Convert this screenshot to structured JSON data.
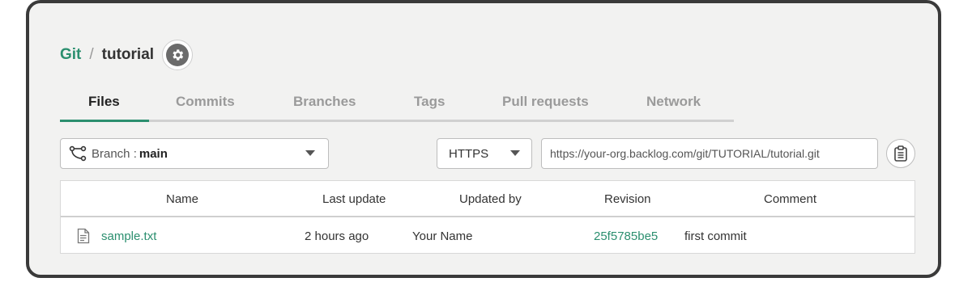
{
  "breadcrumb": {
    "project": "Git",
    "separator": "/",
    "repository": "tutorial",
    "settings_icon": "gear-icon"
  },
  "tabs": [
    {
      "label": "Files",
      "active": true
    },
    {
      "label": "Commits",
      "active": false
    },
    {
      "label": "Branches",
      "active": false
    },
    {
      "label": "Tags",
      "active": false
    },
    {
      "label": "Pull requests",
      "active": false
    },
    {
      "label": "Network",
      "active": false
    }
  ],
  "branch_select": {
    "icon": "branch-icon",
    "label": "Branch :",
    "value": "main"
  },
  "clone": {
    "protocol": "HTTPS",
    "url": "https://your-org.backlog.com/git/TUTORIAL/tutorial.git",
    "copy_icon": "clipboard-icon"
  },
  "table": {
    "columns": [
      "Name",
      "Last update",
      "Updated by",
      "Revision",
      "Comment"
    ],
    "rows": [
      {
        "icon": "file-icon",
        "name": "sample.txt",
        "last_update": "2 hours ago",
        "updated_by": "Your Name",
        "revision": "25f5785be5",
        "comment": "first commit"
      }
    ]
  },
  "colors": {
    "accent": "#2b8f6f",
    "frame_border": "#3a3a3a",
    "panel_bg": "#f2f2f1"
  }
}
